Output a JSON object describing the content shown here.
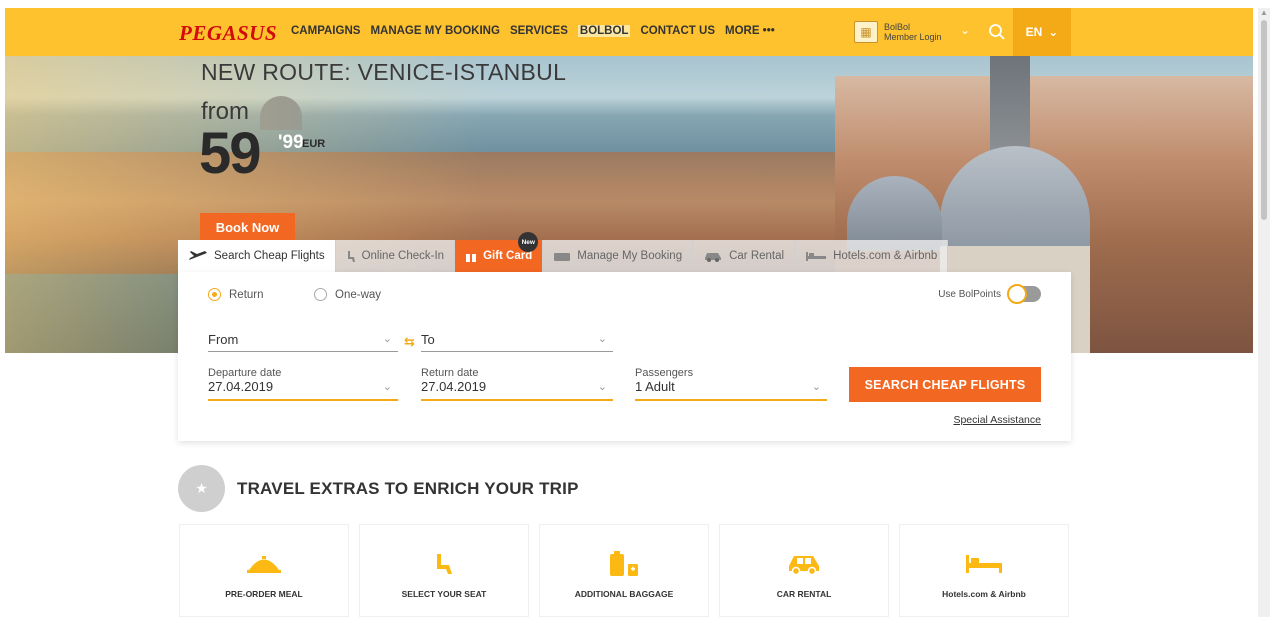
{
  "nav": {
    "logo": "PEGASUS",
    "menu": [
      "CAMPAIGNS",
      "MANAGE MY BOOKING",
      "SERVICES",
      "BOLBOL",
      "CONTACT US",
      "MORE •••"
    ],
    "login_line1": "BolBol",
    "login_line2": "Member Login",
    "lang": "EN"
  },
  "hero": {
    "headline": "NEW ROUTE: VENICE-ISTANBUL",
    "from": "from",
    "price_int": "59",
    "price_dec": "'99",
    "currency": "EUR",
    "book_now": "Book Now"
  },
  "tabs": [
    {
      "label": "Search Cheap Flights"
    },
    {
      "label": "Online Check-In"
    },
    {
      "label": "Gift Card",
      "badge": "New"
    },
    {
      "label": "Manage My Booking"
    },
    {
      "label": "Car Rental"
    },
    {
      "label": "Hotels.com & Airbnb"
    }
  ],
  "search": {
    "trip_return": "Return",
    "trip_oneway": "One-way",
    "use_bolpoints": "Use BolPoints",
    "from_label": "From",
    "to_label": "To",
    "departure_label": "Departure date",
    "departure_value": "27.04.2019",
    "return_label": "Return date",
    "return_value": "27.04.2019",
    "passengers_label": "Passengers",
    "passengers_value": "1 Adult",
    "cta": "SEARCH CHEAP FLIGHTS",
    "special": "Special Assistance"
  },
  "extras": {
    "title": "TRAVEL EXTRAS TO ENRICH YOUR TRIP",
    "cards": [
      {
        "label": "PRE-ORDER MEAL",
        "icon": "cloche-icon"
      },
      {
        "label": "SELECT YOUR SEAT",
        "icon": "seat-icon"
      },
      {
        "label": "ADDITIONAL BAGGAGE",
        "icon": "baggage-icon"
      },
      {
        "label": "CAR RENTAL",
        "icon": "car-icon"
      },
      {
        "label": "Hotels.com & Airbnb",
        "icon": "bed-icon"
      }
    ]
  },
  "colors": {
    "brand_yellow": "#fdc22e",
    "accent_orange": "#f26722",
    "logo_red": "#d20a0a"
  }
}
